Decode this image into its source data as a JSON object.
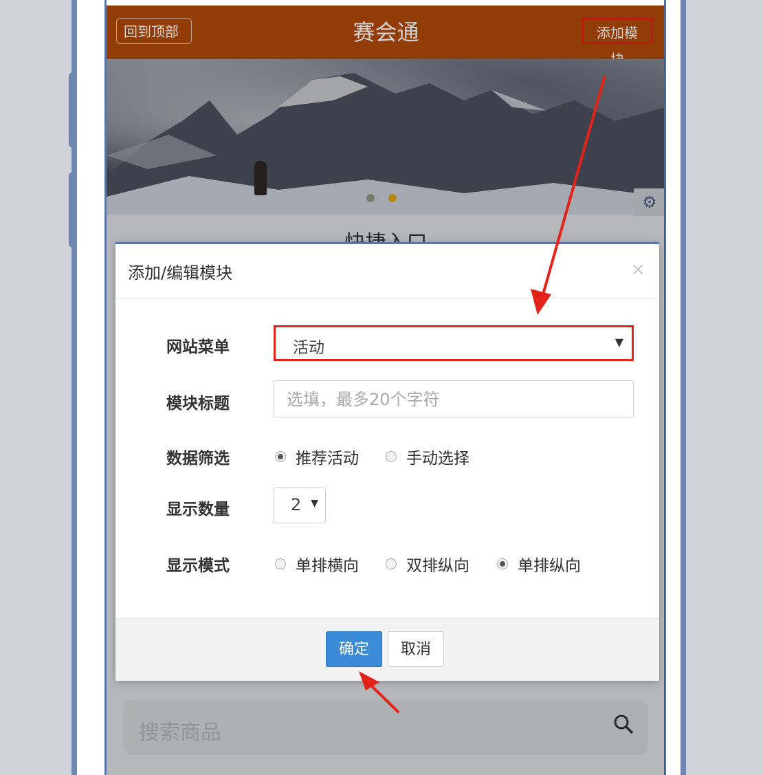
{
  "header": {
    "back_to_top": "回到顶部",
    "app_title": "赛会通",
    "add_module": "添加模块"
  },
  "banner": {
    "settings_icon": "gear-icon"
  },
  "section": {
    "title": "快捷入口"
  },
  "modal": {
    "title": "添加/编辑模块",
    "close_label": "×",
    "fields": {
      "menu_label": "网站菜单",
      "menu_value": "活动",
      "title_label": "模块标题",
      "title_placeholder": "选填，最多20个字符",
      "filter_label": "数据筛选",
      "filter_options": [
        "推荐活动",
        "手动选择"
      ],
      "count_label": "显示数量",
      "count_value": "2",
      "mode_label": "显示模式",
      "mode_options": [
        "单排横向",
        "双排纵向",
        "单排纵向"
      ]
    },
    "confirm": "确定",
    "cancel": "取消"
  },
  "search": {
    "placeholder": "搜索商品",
    "icon": "search-icon"
  },
  "colors": {
    "header_bg": "#b34b09",
    "highlight": "#e2231a",
    "primary_button": "#3a8ad6"
  }
}
